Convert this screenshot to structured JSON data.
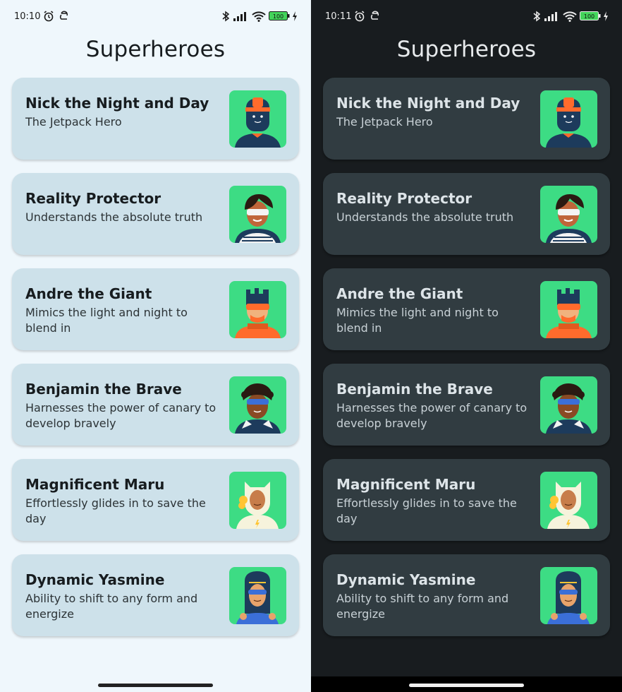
{
  "screens": [
    {
      "theme": "light",
      "status": {
        "time": "10:10",
        "battery": "100"
      }
    },
    {
      "theme": "dark",
      "status": {
        "time": "10:11",
        "battery": "100"
      }
    }
  ],
  "app": {
    "title": "Superheroes"
  },
  "heroes": [
    {
      "name": "Nick the Night and Day",
      "description": "The Jetpack Hero",
      "avatar": "jetpack-hero-avatar"
    },
    {
      "name": "Reality Protector",
      "description": "Understands the absolute truth",
      "avatar": "reality-protector-avatar"
    },
    {
      "name": "Andre the Giant",
      "description": "Mimics the light and night to blend in",
      "avatar": "andre-giant-avatar"
    },
    {
      "name": "Benjamin the Brave",
      "description": "Harnesses the power of canary to develop bravely",
      "avatar": "benjamin-brave-avatar"
    },
    {
      "name": "Magnificent Maru",
      "description": "Effortlessly glides in to save the day",
      "avatar": "magnificent-maru-avatar"
    },
    {
      "name": "Dynamic Yasmine",
      "description": "Ability to shift to any form and energize",
      "avatar": "dynamic-yasmine-avatar"
    }
  ],
  "colors": {
    "light_background": "#eff7fc",
    "light_card": "#cde1ea",
    "dark_background": "#181c1f",
    "dark_card": "#313c41",
    "avatar_background": "#3ddc84"
  }
}
